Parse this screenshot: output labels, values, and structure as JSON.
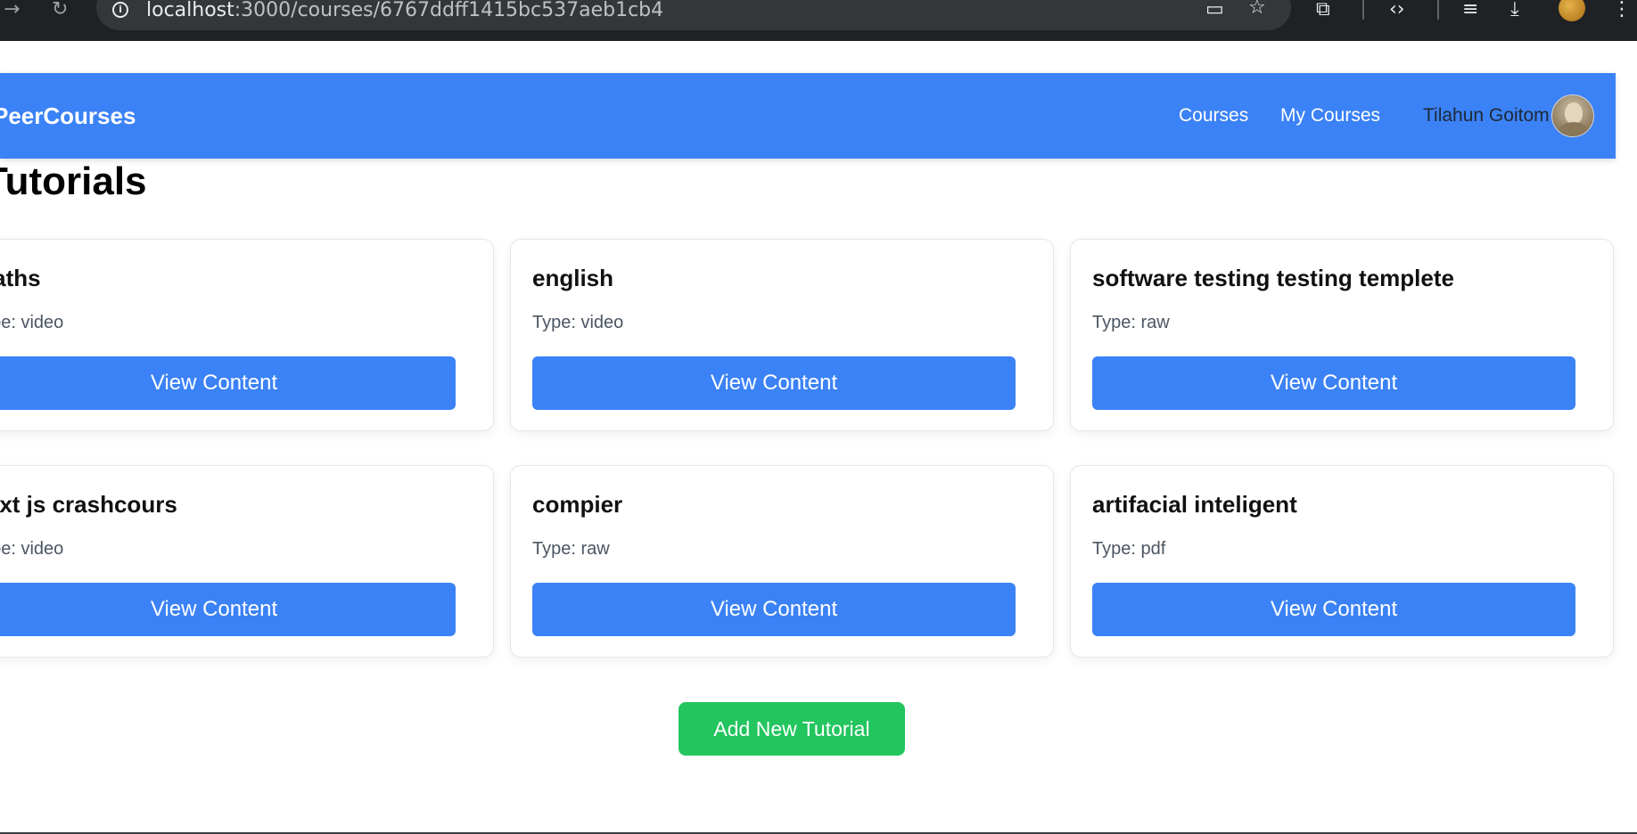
{
  "browser": {
    "url_host": "localhost",
    "url_path": ":3000/courses/6767ddff1415bc537aeb1cb4"
  },
  "navbar": {
    "brand": "PeerCourses",
    "links": [
      "Courses",
      "My Courses"
    ],
    "user_name": "Tilahun Goitom"
  },
  "section_title": "Tutorials",
  "tutorials": [
    {
      "title": "maths",
      "type": "Type: video",
      "button": "View Content"
    },
    {
      "title": "english",
      "type": "Type: video",
      "button": "View Content"
    },
    {
      "title": "software testing testing templete",
      "type": "Type: raw",
      "button": "View Content"
    },
    {
      "title": "next js crashcours",
      "type": "Type: video",
      "button": "View Content"
    },
    {
      "title": "compier",
      "type": "Type: raw",
      "button": "View Content"
    },
    {
      "title": "artifacial inteligent",
      "type": "Type: pdf",
      "button": "View Content"
    }
  ],
  "add_button": "Add New Tutorial",
  "colors": {
    "navbar": "#3b82f6",
    "primary_button": "#3b82f6",
    "add_button": "#22c55e"
  }
}
